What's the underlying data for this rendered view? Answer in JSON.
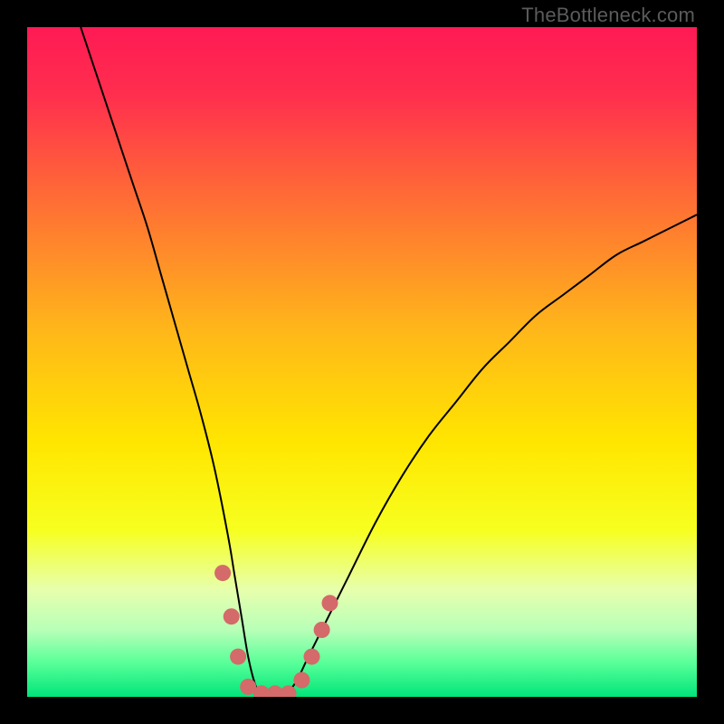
{
  "watermark": "TheBottleneck.com",
  "chart_data": {
    "type": "line",
    "title": "",
    "xlabel": "",
    "ylabel": "",
    "xlim": [
      0,
      100
    ],
    "ylim": [
      0,
      100
    ],
    "background_gradient_stops": [
      {
        "pos": 0.0,
        "color": "#ff1a54"
      },
      {
        "pos": 0.1,
        "color": "#ff2e4e"
      },
      {
        "pos": 0.25,
        "color": "#ff6a36"
      },
      {
        "pos": 0.45,
        "color": "#ffb61a"
      },
      {
        "pos": 0.62,
        "color": "#ffe600"
      },
      {
        "pos": 0.75,
        "color": "#f7ff1f"
      },
      {
        "pos": 0.84,
        "color": "#e7ffad"
      },
      {
        "pos": 0.9,
        "color": "#b8ffb8"
      },
      {
        "pos": 0.95,
        "color": "#57ff98"
      },
      {
        "pos": 1.0,
        "color": "#00e57a"
      }
    ],
    "series": [
      {
        "name": "bottleneck-curve",
        "color": "#000000",
        "stroke_width": 2,
        "x": [
          8,
          10,
          12,
          14,
          16,
          18,
          20,
          22,
          24,
          26,
          28,
          30,
          31,
          32,
          33,
          34,
          35,
          36,
          38,
          40,
          42,
          45,
          48,
          52,
          56,
          60,
          64,
          68,
          72,
          76,
          80,
          84,
          88,
          92,
          96,
          100
        ],
        "y": [
          100,
          94,
          88,
          82,
          76,
          70,
          63,
          56,
          49,
          42,
          34,
          24,
          18,
          12,
          6,
          2,
          0,
          0,
          0,
          2,
          6,
          12,
          18,
          26,
          33,
          39,
          44,
          49,
          53,
          57,
          60,
          63,
          66,
          68,
          70,
          72
        ]
      }
    ],
    "markers": {
      "name": "highlight-dots",
      "color": "#d46a6a",
      "radius": 9,
      "points": [
        {
          "x": 29.2,
          "y": 18.5
        },
        {
          "x": 30.5,
          "y": 12.0
        },
        {
          "x": 31.5,
          "y": 6.0
        },
        {
          "x": 33.0,
          "y": 1.5
        },
        {
          "x": 35.0,
          "y": 0.5
        },
        {
          "x": 37.0,
          "y": 0.5
        },
        {
          "x": 39.0,
          "y": 0.5
        },
        {
          "x": 41.0,
          "y": 2.5
        },
        {
          "x": 42.5,
          "y": 6.0
        },
        {
          "x": 44.0,
          "y": 10.0
        },
        {
          "x": 45.2,
          "y": 14.0
        }
      ]
    }
  }
}
